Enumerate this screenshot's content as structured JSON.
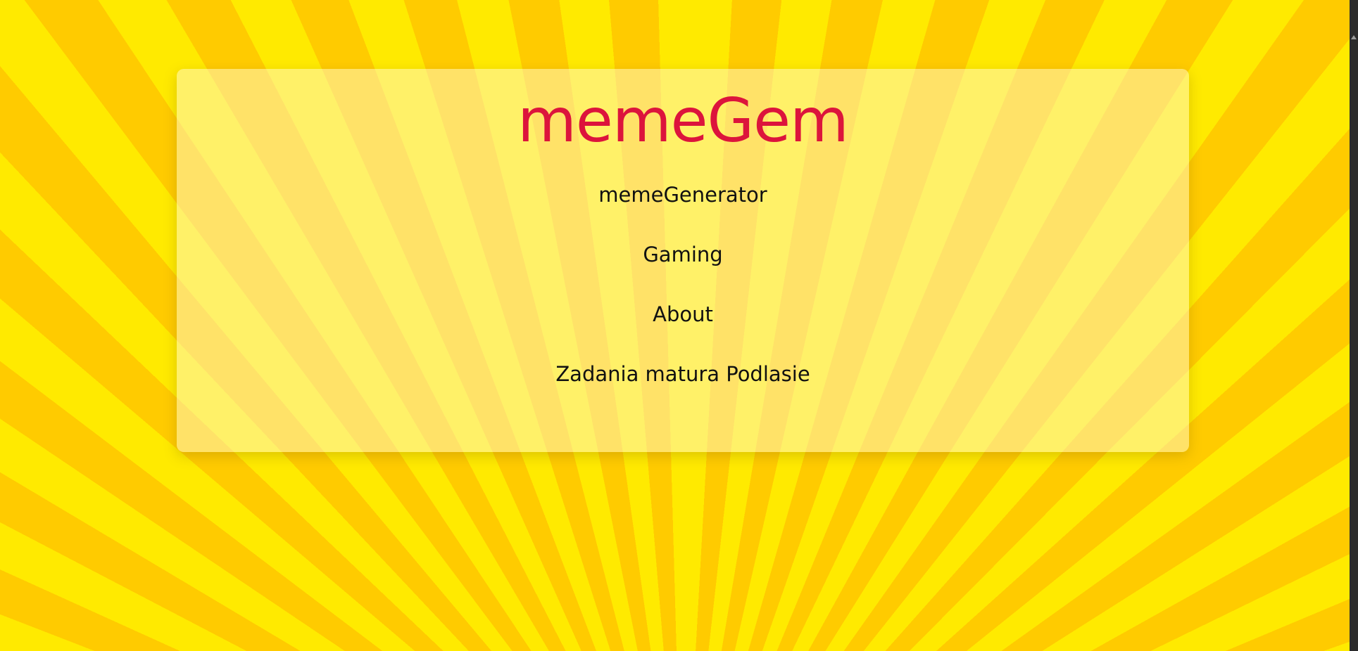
{
  "site": {
    "title": "memeGem",
    "title_color": "#dc143c"
  },
  "nav": {
    "items": [
      {
        "label": "memeGenerator"
      },
      {
        "label": "Gaming"
      },
      {
        "label": "About"
      },
      {
        "label": "Zadania matura Podlasie"
      }
    ]
  },
  "background": {
    "ray_color_light": "#ffea00",
    "ray_color_dark": "#ffcb00"
  }
}
